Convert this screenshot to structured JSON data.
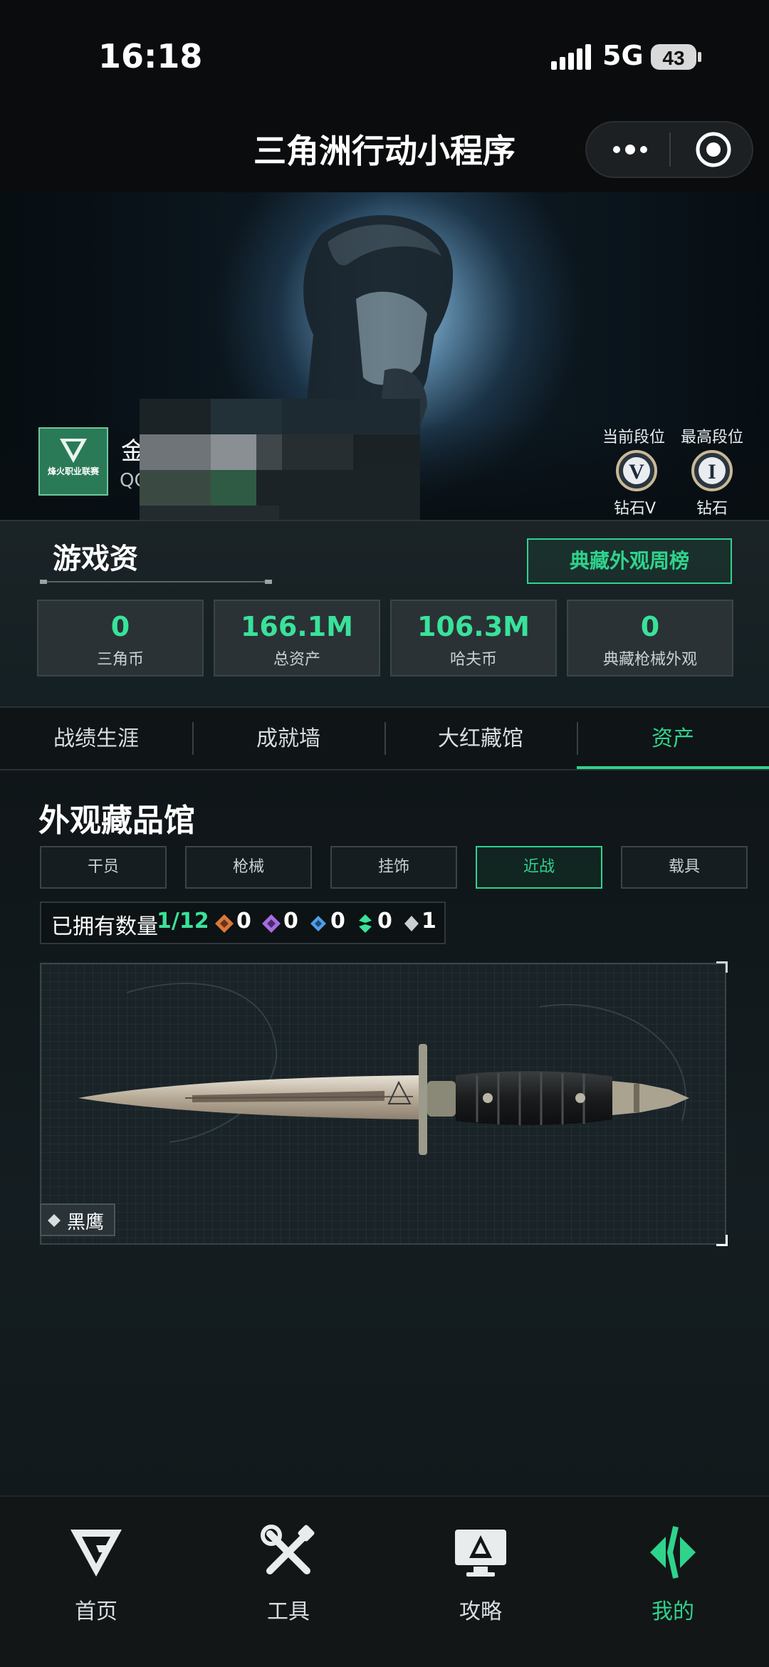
{
  "status_bar": {
    "time": "16:18",
    "network": "5G",
    "battery": "43"
  },
  "nav": {
    "title": "三角洲行动小程序"
  },
  "profile": {
    "name_visible": "金",
    "sub_visible": "QC",
    "league_logo_text": "烽火职业联赛",
    "rank_current_label": "当前段位",
    "rank_max_label": "最高段位",
    "rank_current_name": "钻石V",
    "rank_max_name": "钻石",
    "rank_current_numeral": "V",
    "rank_max_numeral": "I"
  },
  "stats_section": {
    "title": "游戏资",
    "weekly_button": "典藏外观周榜",
    "items": [
      {
        "value": "0",
        "label": "三角币"
      },
      {
        "value": "166.1M",
        "label": "总资产"
      },
      {
        "value": "106.3M",
        "label": "哈夫币"
      },
      {
        "value": "0",
        "label": "典藏枪械外观"
      }
    ]
  },
  "tabs": [
    {
      "label": "战绩生涯"
    },
    {
      "label": "成就墙"
    },
    {
      "label": "大红藏馆"
    },
    {
      "label": "资产"
    }
  ],
  "gallery": {
    "title": "外观藏品馆",
    "categories": [
      "干员",
      "枪械",
      "挂饰",
      "近战",
      "载具"
    ],
    "active_category": "近战",
    "owned_label": "已拥有数量",
    "owned_count": "1/12",
    "rarity_counts": [
      {
        "color": "#d9783a",
        "count": "0"
      },
      {
        "color": "#a86be0",
        "count": "0"
      },
      {
        "color": "#4f9ee8",
        "count": "0"
      },
      {
        "color": "#39e29a",
        "count": "0"
      },
      {
        "color": "#c9cfd2",
        "count": "1"
      }
    ],
    "item_name": "黑鹰"
  },
  "bottom_nav": [
    {
      "label": "首页",
      "icon": "home-logo-icon"
    },
    {
      "label": "工具",
      "icon": "tools-icon"
    },
    {
      "label": "攻略",
      "icon": "guide-monitor-icon"
    },
    {
      "label": "我的",
      "icon": "profile-logo-icon"
    }
  ],
  "colors": {
    "accent": "#2fd38c",
    "background": "#0b0f10"
  }
}
